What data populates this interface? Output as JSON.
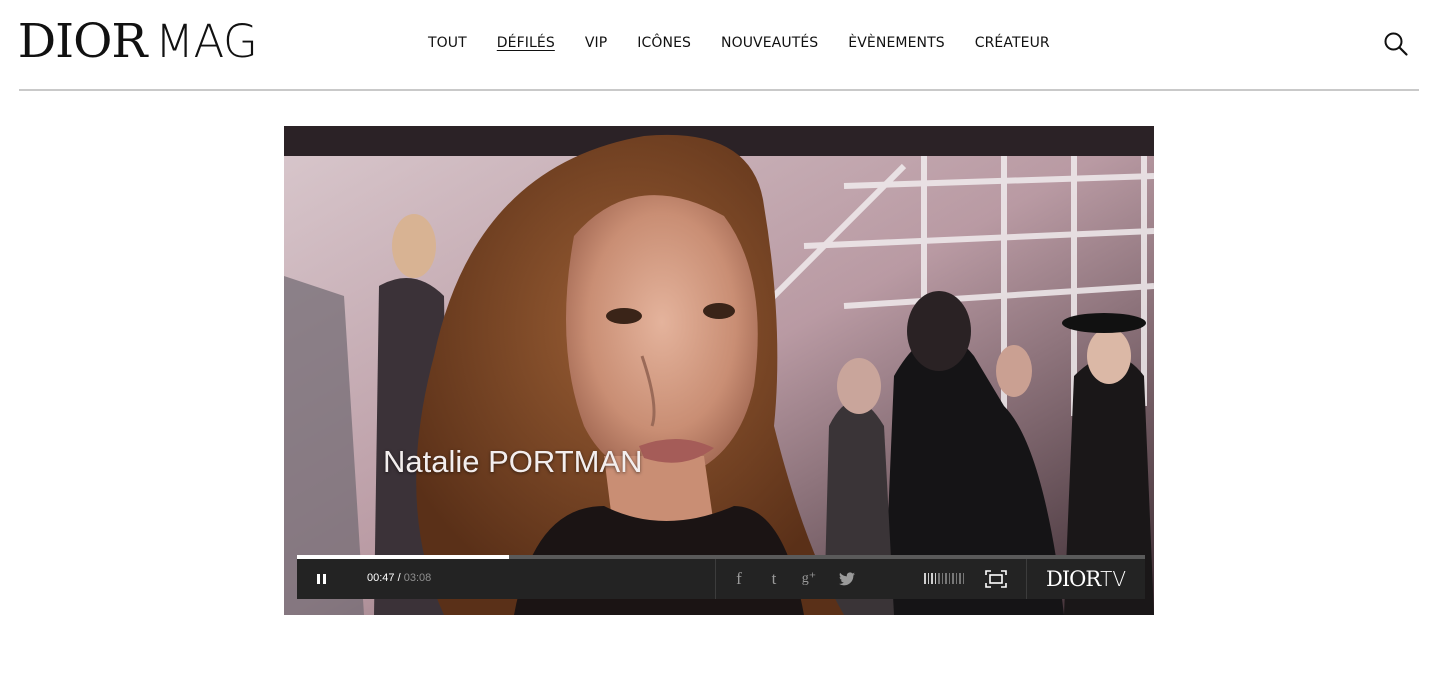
{
  "header": {
    "logo_dior": "DIOR",
    "logo_mag": "MAG",
    "nav": [
      {
        "label": "TOUT",
        "active": false
      },
      {
        "label": "DÉFILÉS",
        "active": true
      },
      {
        "label": "VIP",
        "active": false
      },
      {
        "label": "ICÔNES",
        "active": false
      },
      {
        "label": "NOUVEAUTÉS",
        "active": false
      },
      {
        "label": "ÈVÈNEMENTS",
        "active": false
      },
      {
        "label": "CRÉATEUR",
        "active": false
      }
    ],
    "search_icon": "search-icon"
  },
  "video": {
    "caption": "Natalie PORTMAN",
    "current_time": "00:47",
    "time_separator": " / ",
    "total_time": "03:08",
    "progress": 0.25,
    "share_icons": [
      "facebook-icon",
      "tumblr-icon",
      "google-plus-icon",
      "twitter-icon"
    ],
    "share_glyphs": [
      "f",
      "t",
      "g⁺",
      "🐦"
    ],
    "brand_dior": "DIOR",
    "brand_tv": "TV"
  },
  "colors": {
    "control_bar": "#232323",
    "progress": "#ffffff",
    "text": "#111111"
  }
}
